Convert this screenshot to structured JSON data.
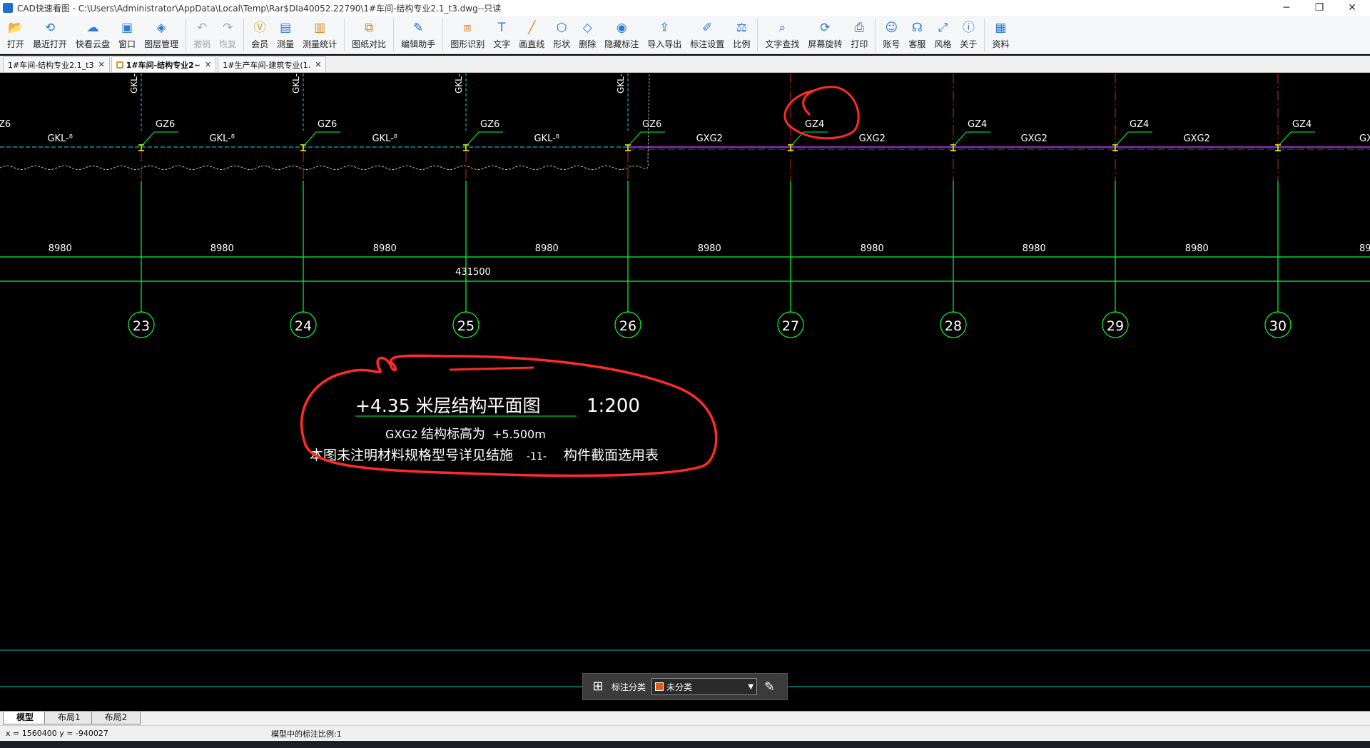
{
  "window": {
    "title": "CAD快速看图 - C:\\Users\\Administrator\\AppData\\Local\\Temp\\Rar$DIa40052.22790\\1#车间-结构专业2.1_t3.dwg--只读"
  },
  "toolbar": {
    "buttons": [
      {
        "label": "打开",
        "icon": "folder-icon",
        "glyph": "📂",
        "color": "#2a7ad8"
      },
      {
        "label": "最近打开",
        "icon": "history-icon",
        "glyph": "⟲",
        "color": "#2a7ad8"
      },
      {
        "label": "快看云盘",
        "icon": "cloud-icon",
        "glyph": "☁",
        "color": "#2a7ad8"
      },
      {
        "label": "窗口",
        "icon": "window-icon",
        "glyph": "▣",
        "color": "#2a7ad8"
      },
      {
        "label": "图层管理",
        "icon": "layers-icon",
        "glyph": "◈",
        "color": "#2a7ad8"
      },
      {
        "label": "撤销",
        "icon": "undo-icon",
        "glyph": "↶",
        "color": "#aaaaaa",
        "disabled": true
      },
      {
        "label": "恢复",
        "icon": "redo-icon",
        "glyph": "↷",
        "color": "#aaaaaa",
        "disabled": true
      },
      {
        "label": "会员",
        "icon": "vip-icon",
        "glyph": "Ⓥ",
        "color": "#d89a1e"
      },
      {
        "label": "测量",
        "icon": "measure-icon",
        "glyph": "▤",
        "color": "#2a7ad8"
      },
      {
        "label": "测量统计",
        "icon": "measure-stats-icon",
        "glyph": "▥",
        "color": "#d8871e"
      },
      {
        "label": "图纸对比",
        "icon": "compare-icon",
        "glyph": "⧉",
        "color": "#d8871e"
      },
      {
        "label": "编辑助手",
        "icon": "edit-assistant-icon",
        "glyph": "✎",
        "color": "#1f6fd0"
      },
      {
        "label": "图形识别",
        "icon": "shape-recognize-icon",
        "glyph": "⧈",
        "color": "#d8871e"
      },
      {
        "label": "文字",
        "icon": "text-icon",
        "glyph": "T",
        "color": "#2a7ad8"
      },
      {
        "label": "画直线",
        "icon": "line-icon",
        "glyph": "╱",
        "color": "#d8871e"
      },
      {
        "label": "形状",
        "icon": "shape-icon",
        "glyph": "⬡",
        "color": "#2a7ad8"
      },
      {
        "label": "删除",
        "icon": "eraser-icon",
        "glyph": "◇",
        "color": "#2a7ad8"
      },
      {
        "label": "隐藏标注",
        "icon": "hide-eye-icon",
        "glyph": "◉",
        "color": "#2a7ad8"
      },
      {
        "label": "导入导出",
        "icon": "import-export-icon",
        "glyph": "⇪",
        "color": "#2a7ad8"
      },
      {
        "label": "标注设置",
        "icon": "annotation-settings-icon",
        "glyph": "✐",
        "color": "#2a7ad8"
      },
      {
        "label": "比例",
        "icon": "scale-icon",
        "glyph": "⚖",
        "color": "#2a7ad8"
      },
      {
        "label": "文字查找",
        "icon": "text-search-icon",
        "glyph": "⌕",
        "color": "#2a7ad8"
      },
      {
        "label": "屏幕旋转",
        "icon": "rotate-screen-icon",
        "glyph": "⟳",
        "color": "#2a7ad8"
      },
      {
        "label": "打印",
        "icon": "printer-icon",
        "glyph": "⎙",
        "color": "#2a7ad8"
      },
      {
        "label": "账号",
        "icon": "user-icon",
        "glyph": "☺",
        "color": "#2a7ad8"
      },
      {
        "label": "客服",
        "icon": "headset-icon",
        "glyph": "☊",
        "color": "#2a7ad8"
      },
      {
        "label": "风格",
        "icon": "style-icon",
        "glyph": "⤢",
        "color": "#2a7ad8"
      },
      {
        "label": "关于",
        "icon": "info-icon",
        "glyph": "ⓘ",
        "color": "#2a7ad8"
      },
      {
        "label": "资料",
        "icon": "docs-icon",
        "glyph": "▦",
        "color": "#2a7ad8"
      }
    ]
  },
  "tabs": [
    {
      "label": "1#车间-结构专业2.1_t3",
      "active": false,
      "locked": false
    },
    {
      "label": "1#车间-结构专业2~",
      "active": true,
      "locked": true
    },
    {
      "label": "1#生产车间-建筑专业(1.",
      "active": false,
      "locked": false
    }
  ],
  "drawing": {
    "top_labels": {
      "gkl_vertical": "GKL-",
      "left_partial_col": "Z6",
      "gkl": "GKL-⁸",
      "gz6": "GZ6",
      "gz4": "GZ4",
      "gxg2": "GXG2"
    },
    "dimension_value": "8980",
    "total_dimension": "431500",
    "axis_numbers": [
      "23",
      "24",
      "25",
      "26",
      "27",
      "28",
      "29",
      "30"
    ],
    "title_block": {
      "title": "+4.35 米层结构平面图",
      "scale": "1:200",
      "note1_code": "GXG2",
      "note1_text": "结构标高为",
      "note1_value": "+5.500m",
      "note2_text": "本图未注明材料规格型号详见结施",
      "note2_ref": "-11-",
      "note2_tail": "构件截面选用表"
    },
    "colors": {
      "grid": "#00ff33",
      "dash_cyan": "#00e5ff",
      "annotation_red": "#ff2a2a",
      "beam_purple": "#c040ff",
      "marker_yellow": "#ffff00",
      "white": "#ffffff",
      "teal_line": "#00bfbf"
    }
  },
  "float_bar": {
    "label": "标注分类",
    "selected": "未分类",
    "swatch_color": "#e65a1a"
  },
  "layout_tabs": [
    "模型",
    "布局1",
    "布局2"
  ],
  "status": {
    "coords": "x = 1560400  y = -940027",
    "scale_text": "模型中的标注比例:1"
  }
}
